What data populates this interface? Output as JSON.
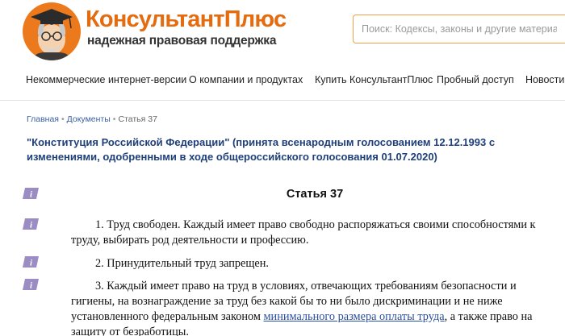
{
  "brand": {
    "name": "КонсультантПлюс",
    "tagline": "надежная правовая поддержка"
  },
  "search": {
    "placeholder": "Поиск: Кодексы, законы и другие материалы"
  },
  "nav": {
    "items": [
      "Некоммерческие интернет-версии",
      "О компании и продуктах",
      "Купить КонсультантПлюс",
      "Пробный доступ",
      "Новости"
    ]
  },
  "breadcrumb": {
    "home": "Главная",
    "docs": "Документы",
    "current": "Статья 37",
    "sep": "•"
  },
  "document": {
    "title": "\"Конституция Российской Федерации\" (принята всенародным голосованием 12.12.1993 с изменениями, одобренными в ходе общероссийского голосования 01.07.2020)",
    "article_heading": "Статья 37",
    "p1": "1. Труд свободен. Каждый имеет право свободно распоряжаться своими способностями к труду, выбирать род деятельности и профессию.",
    "p2": "2. Принудительный труд запрещен.",
    "p3_before": "3. Каждый имеет право на труд в условиях, отвечающих требованиям безопасности и гигиены, на вознаграждение за труд без какой бы то ни было дискриминации и не ниже установленного федеральным законом ",
    "p3_link": "минимального размера оплаты труда",
    "p3_after": ", а также право на защиту от безработицы."
  },
  "colors": {
    "brand_orange": "#e46b0e",
    "title_blue": "#1e3f7a",
    "info_icon_purple": "#9b8cc4"
  },
  "icons": [
    "consultant-logo-icon",
    "info-icon"
  ]
}
